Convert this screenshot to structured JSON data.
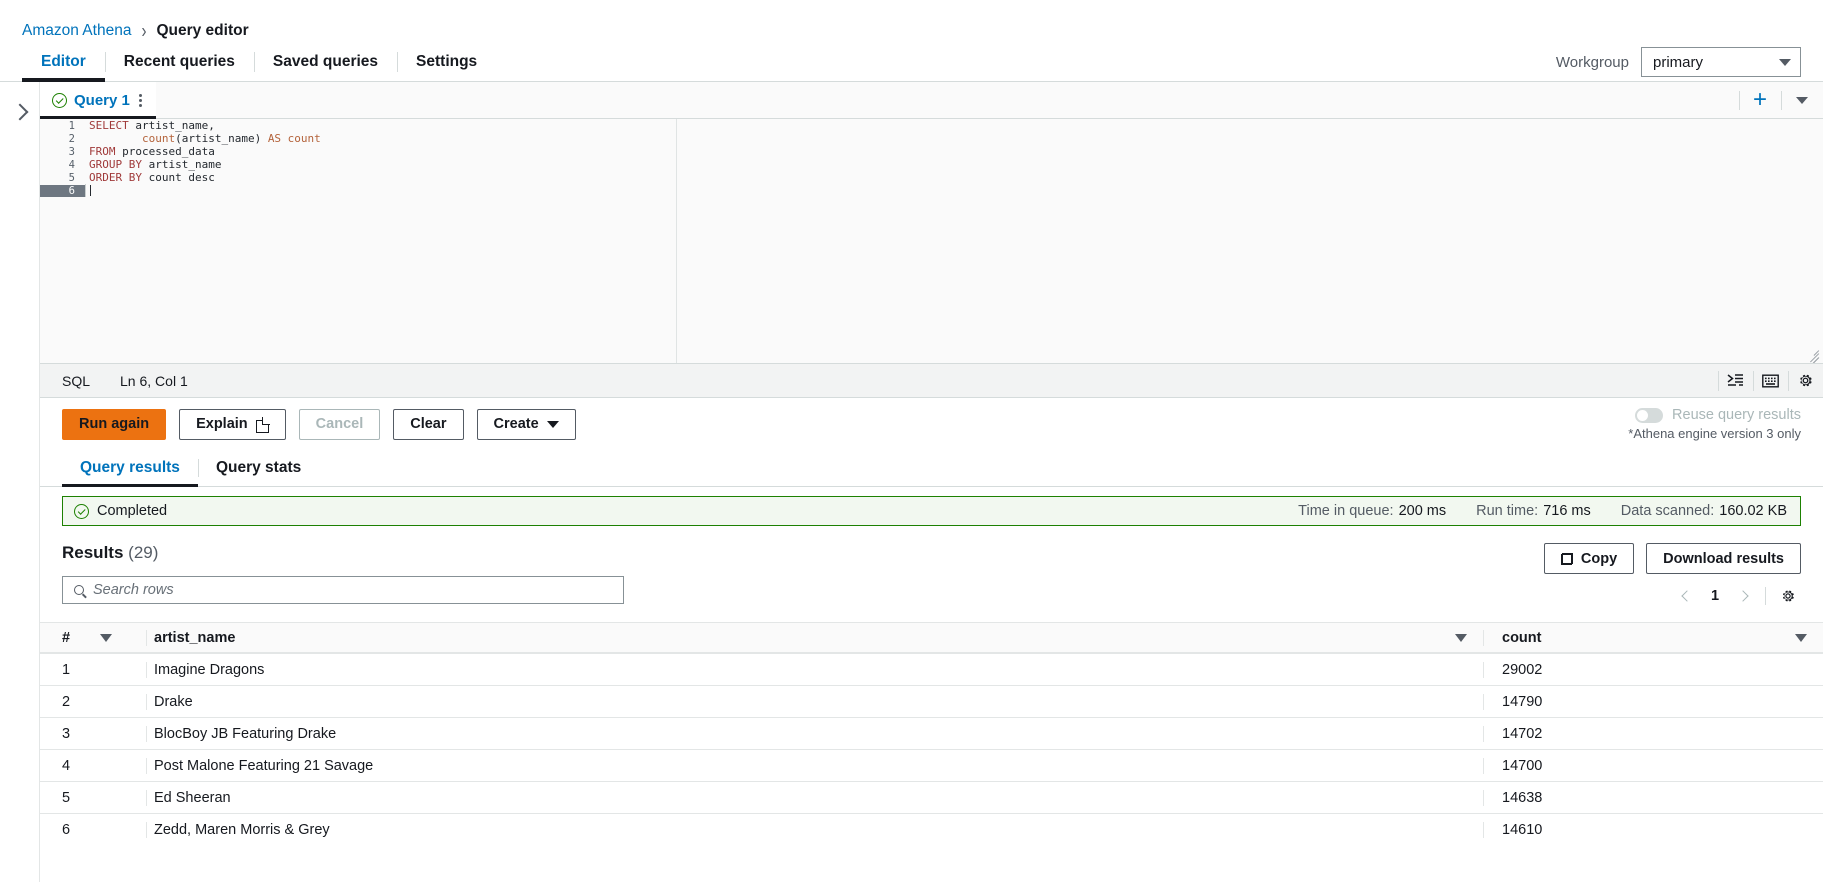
{
  "breadcrumb": {
    "root": "Amazon Athena",
    "separator": "›",
    "current": "Query editor"
  },
  "nav_tabs": [
    {
      "label": "Editor",
      "active": true
    },
    {
      "label": "Recent queries",
      "active": false
    },
    {
      "label": "Saved queries",
      "active": false
    },
    {
      "label": "Settings",
      "active": false
    }
  ],
  "workgroup": {
    "label": "Workgroup",
    "value": "primary"
  },
  "query_tab": {
    "label": "Query 1",
    "status_icon": "check-circle-icon",
    "menu_icon": "kebab-menu-icon"
  },
  "editor": {
    "language": "SQL",
    "cursor_position": "Ln 6, Col 1",
    "lines": [
      {
        "n": "1",
        "tokens": [
          {
            "t": "SELECT",
            "c": "kw"
          },
          {
            "t": " artist_name,",
            "c": "id"
          }
        ]
      },
      {
        "n": "2",
        "tokens": [
          {
            "t": "        count",
            "c": "fn"
          },
          {
            "t": "(artist_name) ",
            "c": "id"
          },
          {
            "t": "AS count",
            "c": "fn"
          }
        ]
      },
      {
        "n": "3",
        "tokens": [
          {
            "t": "FROM",
            "c": "kw"
          },
          {
            "t": " processed_data",
            "c": "id"
          }
        ]
      },
      {
        "n": "4",
        "tokens": [
          {
            "t": "GROUP BY",
            "c": "kw"
          },
          {
            "t": " artist_name",
            "c": "id"
          }
        ]
      },
      {
        "n": "5",
        "tokens": [
          {
            "t": "ORDER BY",
            "c": "kw"
          },
          {
            "t": " count desc",
            "c": "id"
          }
        ]
      },
      {
        "n": "6",
        "tokens": [],
        "active": true
      }
    ]
  },
  "editor_tab_controls": {
    "new_tab_icon": "plus-icon",
    "more_tabs_icon": "chevron-down-icon"
  },
  "editor_tools": [
    {
      "name": "format-query-icon",
      "glyph": "⤑"
    },
    {
      "name": "keyboard-shortcuts-icon",
      "glyph": "⌨"
    },
    {
      "name": "editor-settings-gear-icon",
      "glyph": "⚙"
    }
  ],
  "actions": {
    "run": "Run again",
    "explain": "Explain",
    "cancel": "Cancel",
    "clear": "Clear",
    "create": "Create",
    "reuse_toggle_label": "Reuse query results",
    "engine_note": "*Athena engine version 3 only",
    "primary_color": "#ec7211"
  },
  "result_tabs": [
    {
      "label": "Query results",
      "active": true
    },
    {
      "label": "Query stats",
      "active": false
    }
  ],
  "status_banner": {
    "state": "Completed",
    "accent_color": "#1d8102",
    "metrics": [
      {
        "label": "Time in queue:",
        "value": "200 ms"
      },
      {
        "label": "Run time:",
        "value": "716 ms"
      },
      {
        "label": "Data scanned:",
        "value": "160.02 KB"
      }
    ]
  },
  "results": {
    "title": "Results",
    "count": "(29)",
    "search_placeholder": "Search rows",
    "copy_label": "Copy",
    "download_label": "Download results",
    "page_number": "1",
    "settings_icon": "gear-icon",
    "columns": [
      "#",
      "artist_name",
      "count"
    ],
    "rows": [
      {
        "num": "1",
        "artist_name": "Imagine Dragons",
        "count": "29002"
      },
      {
        "num": "2",
        "artist_name": "Drake",
        "count": "14790"
      },
      {
        "num": "3",
        "artist_name": "BlocBoy JB Featuring Drake",
        "count": "14702"
      },
      {
        "num": "4",
        "artist_name": "Post Malone Featuring 21 Savage",
        "count": "14700"
      },
      {
        "num": "5",
        "artist_name": "Ed Sheeran",
        "count": "14638"
      },
      {
        "num": "6",
        "artist_name": "Zedd, Maren Morris & Grey",
        "count": "14610"
      }
    ]
  }
}
